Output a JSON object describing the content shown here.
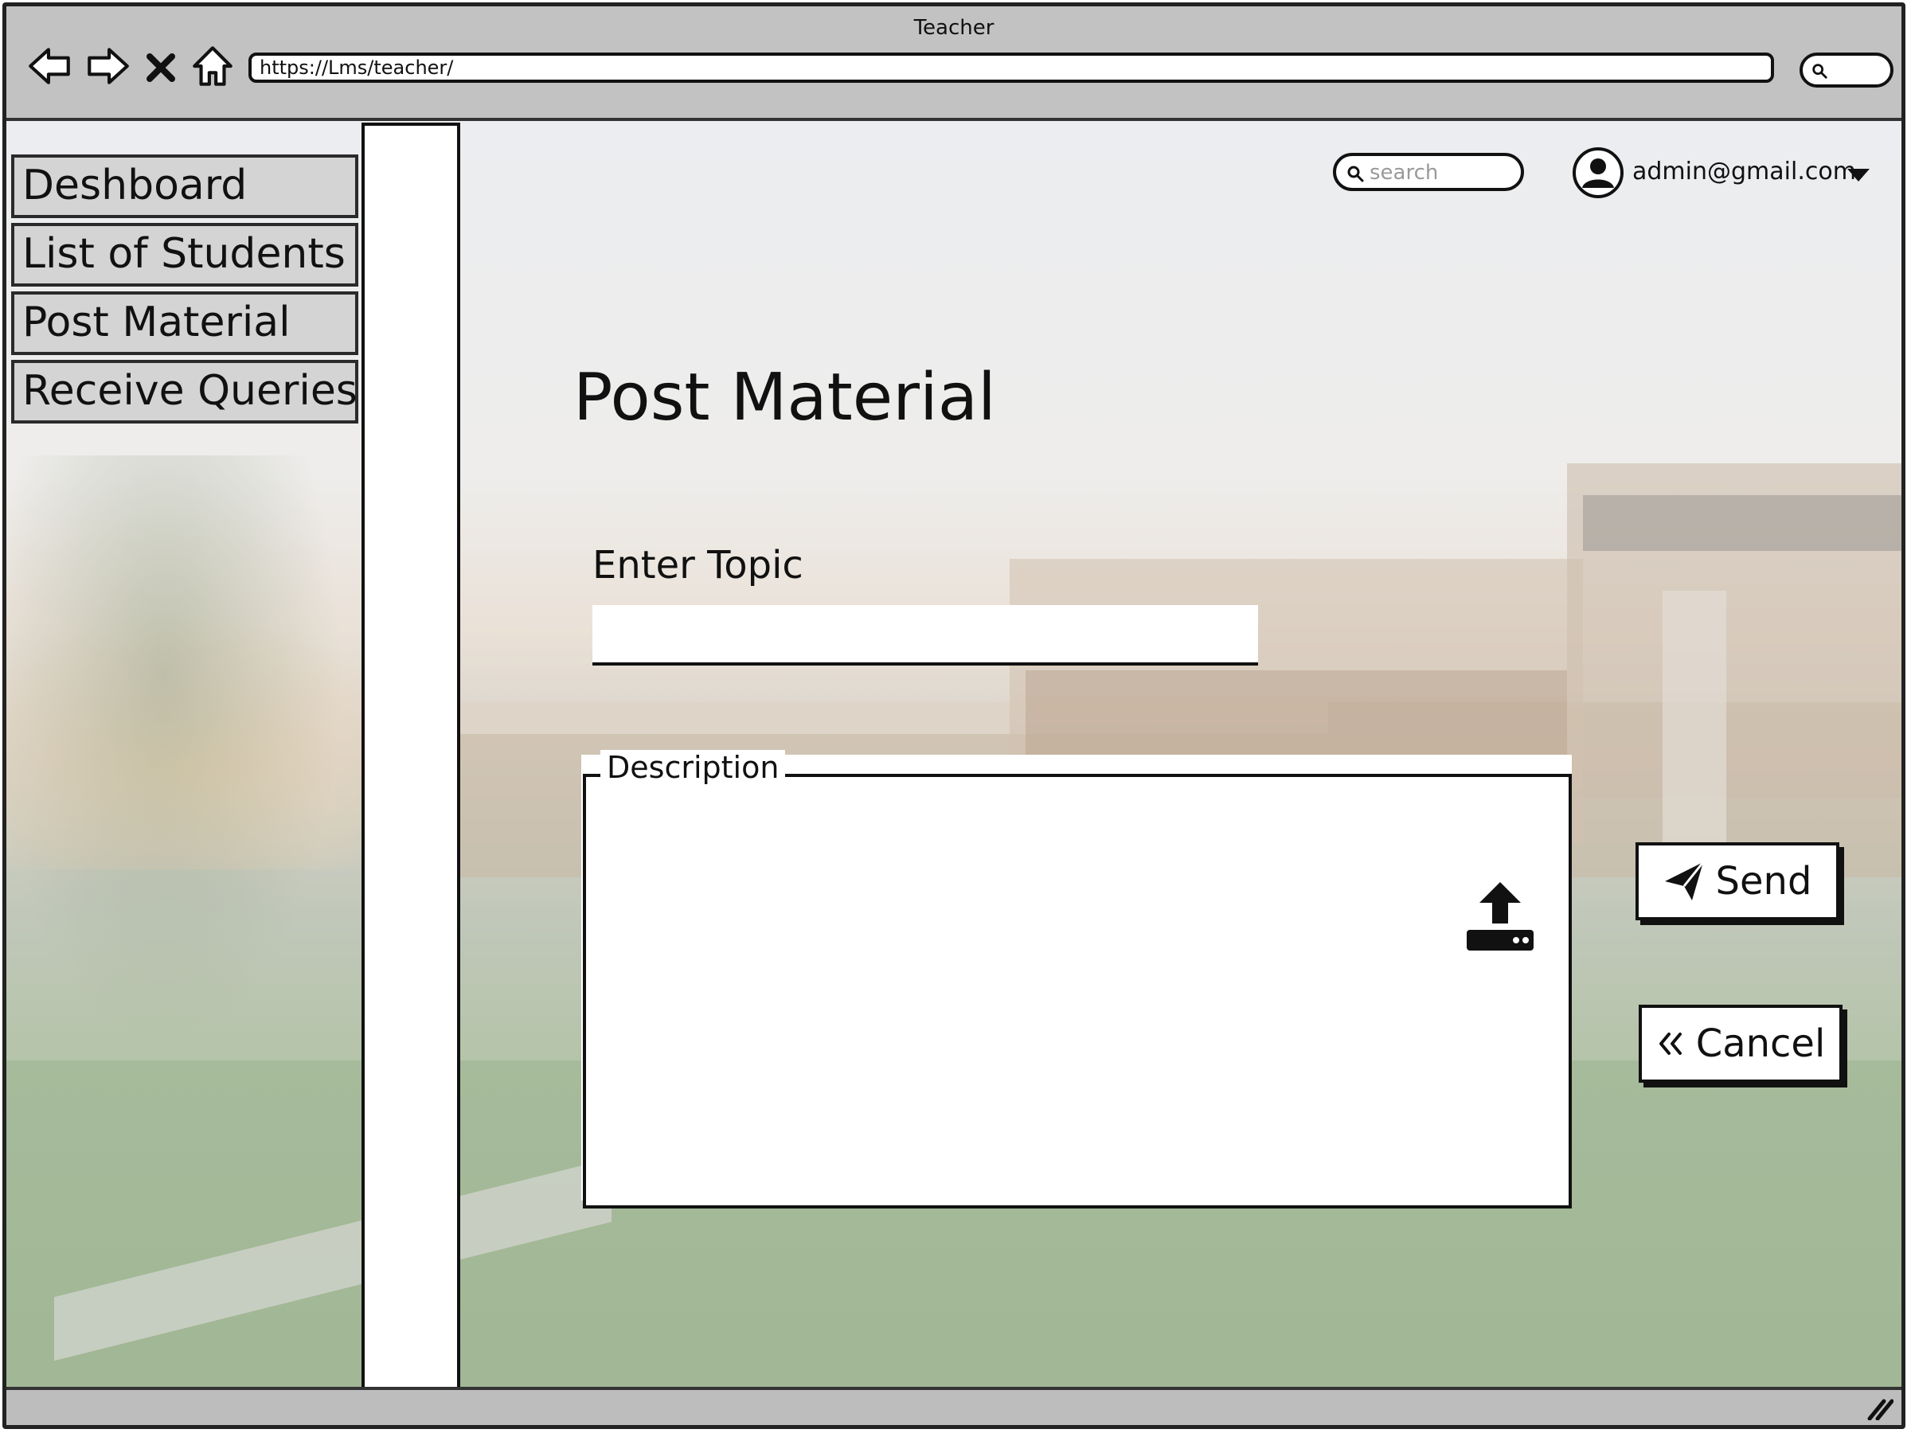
{
  "window": {
    "title": "Teacher"
  },
  "browser": {
    "url": "https://Lms/teacher/",
    "nav_icons": [
      "back-icon",
      "forward-icon",
      "close-icon",
      "home-icon"
    ],
    "search_icon": "search-icon"
  },
  "sidebar": {
    "items": [
      {
        "label": "Deshboard"
      },
      {
        "label": "List of Students"
      },
      {
        "label": "Post Material"
      },
      {
        "label": "Receive Queries"
      }
    ]
  },
  "header": {
    "search_placeholder": "search",
    "user_email": "admin@gmail.com",
    "avatar_icon": "user-avatar-icon",
    "dropdown_icon": "caret-down-icon"
  },
  "form": {
    "title": "Post Material",
    "topic_label": "Enter Topic",
    "topic_value": "",
    "description_label": "Description",
    "description_value": "",
    "upload_icon": "upload-icon",
    "send_label": "Send",
    "cancel_label": "Cancel"
  },
  "colors": {
    "chrome": "#c2c2c2",
    "sidebar_item": "#d4d4d4",
    "outline": "#111111"
  }
}
